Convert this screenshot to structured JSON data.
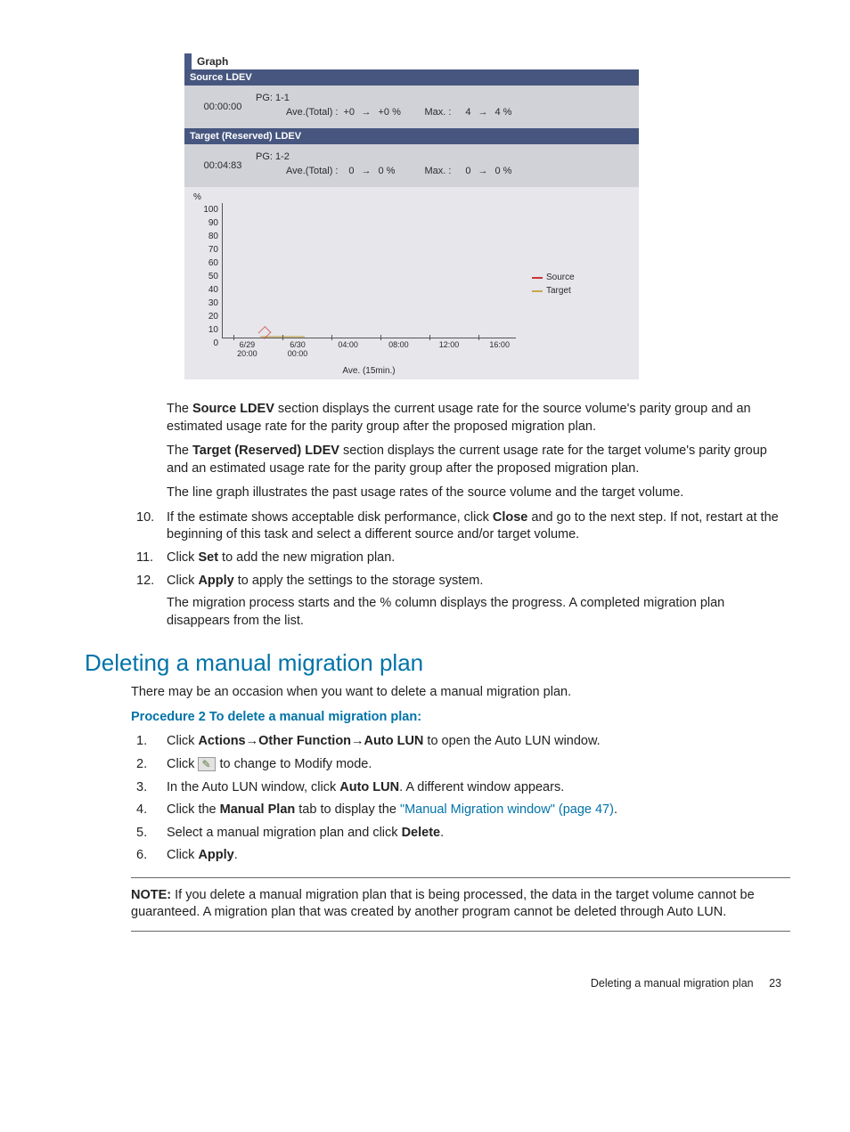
{
  "graph_panel": {
    "title": "Graph",
    "source": {
      "header": "Source LDEV",
      "time": "00:00:00",
      "pg": "PG: 1-1",
      "ave_label": "Ave.(Total) :",
      "ave_from": "+0",
      "ave_to": "+0 %",
      "max_label": "Max. :",
      "max_from": "4",
      "max_to": "4 %"
    },
    "target": {
      "header": "Target (Reserved) LDEV",
      "time": "00:04:83",
      "pg": "PG: 1-2",
      "ave_label": "Ave.(Total) :",
      "ave_from": "0",
      "ave_to": "0 %",
      "max_label": "Max. :",
      "max_from": "0",
      "max_to": "0 %"
    },
    "legend": {
      "source": "Source",
      "target": "Target"
    }
  },
  "chart_data": {
    "type": "line",
    "ylabel": "%",
    "xlabel": "Ave. (15min.)",
    "y_ticks": [
      "100",
      "90",
      "80",
      "70",
      "60",
      "50",
      "40",
      "30",
      "20",
      "10",
      "0"
    ],
    "x_ticks": [
      "6/29\n20:00",
      "6/30\n00:00",
      "04:00",
      "08:00",
      "12:00",
      "16:00"
    ],
    "ylim": [
      0,
      100
    ],
    "series": [
      {
        "name": "Source",
        "color": "#c33",
        "values": [
          0,
          4,
          0,
          0,
          0,
          0
        ]
      },
      {
        "name": "Target",
        "color": "#c5a84f",
        "values": [
          0,
          0,
          0,
          0,
          0,
          0
        ]
      }
    ]
  },
  "text": {
    "p1a": "The ",
    "p1b": "Source LDEV",
    "p1c": " section displays the current usage rate for the source volume's parity group and an estimated usage rate for the parity group after the proposed migration plan.",
    "p2a": "The ",
    "p2b": "Target (Reserved) LDEV",
    "p2c": " section displays the current usage rate for the target volume's parity group and an estimated usage rate for the parity group after the proposed migration plan.",
    "p3": "The line graph illustrates the past usage rates of the source volume and the target volume.",
    "s10": {
      "num": "10.",
      "a": "If the estimate shows acceptable disk performance, click ",
      "b": "Close",
      "c": " and go to the next step. If not, restart at the beginning of this task and select a different source and/or target volume."
    },
    "s11": {
      "num": "11.",
      "a": "Click ",
      "b": "Set",
      "c": " to add the new migration plan."
    },
    "s12": {
      "num": "12.",
      "a": "Click ",
      "b": "Apply",
      "c": " to apply the settings to the storage system.",
      "sub": "The migration process starts and the % column displays the progress. A completed migration plan disappears from the list."
    },
    "heading2": "Deleting a manual migration plan",
    "intro2": "There may be an occasion when you want to delete a manual migration plan.",
    "proc2_title": "Procedure 2 To delete a manual migration plan:",
    "d1": {
      "num": "1.",
      "a": "Click ",
      "b": "Actions",
      "arr1": "→",
      "c": "Other Function",
      "arr2": "→",
      "d": "Auto LUN",
      "e": " to open the Auto LUN window."
    },
    "d2": {
      "num": "2.",
      "a": "Click ",
      "b": " to change to Modify mode."
    },
    "d3": {
      "num": "3.",
      "a": "In the Auto LUN window, click ",
      "b": "Auto LUN",
      "c": ". A different window appears."
    },
    "d4": {
      "num": "4.",
      "a": "Click the ",
      "b": "Manual Plan",
      "c": " tab to display the ",
      "link": "\"Manual Migration window\" (page 47)",
      "d": "."
    },
    "d5": {
      "num": "5.",
      "a": "Select a manual migration plan and click ",
      "b": "Delete",
      "c": "."
    },
    "d6": {
      "num": "6.",
      "a": "Click ",
      "b": "Apply",
      "c": "."
    },
    "note_label": "NOTE:",
    "note_body": "   If you delete a manual migration plan that is being processed, the data in the target volume cannot be guaranteed. A migration plan that was created by another program cannot be deleted through Auto LUN.",
    "footer_text": "Deleting a manual migration plan",
    "footer_page": "23"
  }
}
